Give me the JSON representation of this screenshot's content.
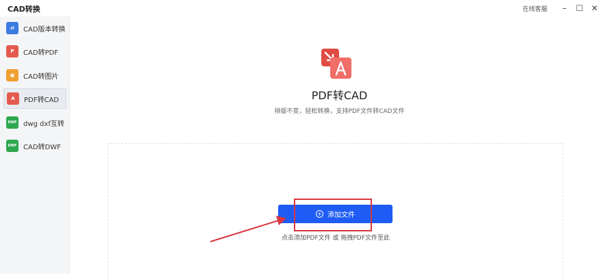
{
  "window": {
    "title": "CAD转换",
    "support": "在线客服",
    "minimize": "–",
    "maximize": "☐",
    "close": "✕"
  },
  "sidebar": {
    "items": [
      {
        "label": "CAD版本转换",
        "color": "#3a7be0",
        "glyph": "⇄",
        "active": false
      },
      {
        "label": "CAD转PDF",
        "color": "#e55a4e",
        "glyph": "P",
        "active": false
      },
      {
        "label": "CAD转图片",
        "color": "#f0a030",
        "glyph": "▣",
        "active": false
      },
      {
        "label": "PDF转CAD",
        "color": "#e55a4e",
        "glyph": "A",
        "active": true
      },
      {
        "label": "dwg dxf互转",
        "color": "#2ea84f",
        "glyph": "DWF",
        "active": false
      },
      {
        "label": "CAD转DWF",
        "color": "#2ea84f",
        "glyph": "DWF",
        "active": false
      }
    ]
  },
  "main": {
    "title": "PDF转CAD",
    "subtitle": "排版不变，轻松转换，支持PDF文件转CAD文件",
    "add_button": "添加文件",
    "hint": "点击添加PDF文件 或 拖拽PDF文件至此"
  },
  "colors": {
    "accent": "#1f5cf5",
    "highlight": "#d9363e",
    "hero_red": "#e04c44"
  }
}
